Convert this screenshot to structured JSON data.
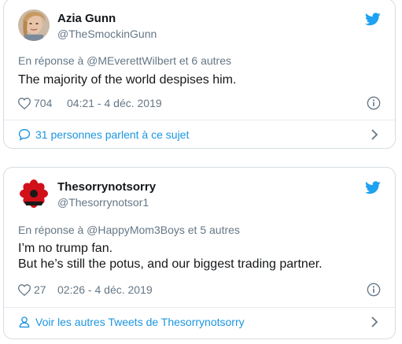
{
  "tweets": [
    {
      "name": "Azia Gunn",
      "handle": "@TheSmockinGunn",
      "reply_prefix": "En réponse à ",
      "reply_mention": "@MEverettWilbert",
      "reply_suffix": " et 6 autres",
      "text_lines": [
        "The majority of the world despises him."
      ],
      "likes": "704",
      "time": "04:21 - 4 déc. 2019",
      "footer": "31 personnes parlent à ce sujet",
      "footer_icon": "speech-bubble-icon"
    },
    {
      "name": "Thesorrynotsorry",
      "handle": "@Thesorrynotsor1",
      "reply_prefix": "En réponse à ",
      "reply_mention": "@HappyMom3Boys",
      "reply_suffix": " et 5 autres",
      "text_lines": [
        "I’m no trump fan.",
        "But he’s still the potus, and our biggest trading partner."
      ],
      "likes": "27",
      "time": "02:26 - 4 déc. 2019",
      "footer": "Voir les autres Tweets de Thesorrynotsorry",
      "footer_icon": "person-icon"
    }
  ],
  "colors": {
    "twitter_blue": "#1da1f2",
    "link_blue": "#1b95e0",
    "secondary_text": "#657786",
    "primary_text": "#14171a",
    "border": "#d6dde3"
  }
}
